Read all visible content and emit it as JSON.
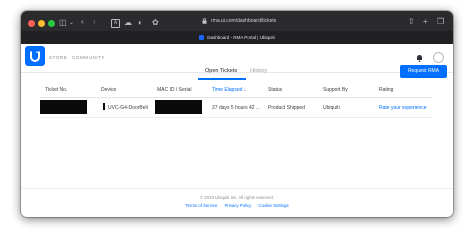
{
  "browser": {
    "address": "rma.ui.com/dashboard/tickets",
    "tab_title": "Dashboard - RMA Portal | Ubiquiti"
  },
  "nav": {
    "store": "STORE",
    "community": "COMMUNITY"
  },
  "subtabs": [
    {
      "label": "Open Tickets",
      "active": true
    },
    {
      "label": "History",
      "active": false
    }
  ],
  "request_rma_label": "Request RMA",
  "table": {
    "columns": [
      "Ticket No.",
      "Device",
      "MAC ID / Serial",
      "Time Elapsed",
      "Status",
      "Support By",
      "Rating"
    ],
    "sorted_column": "Time Elapsed",
    "rows": [
      {
        "ticket_no": "",
        "device": "UVC-G4-DoorBell",
        "mac_serial": "",
        "time_elapsed": "27 days 5 hours 42 ...",
        "status": "Product Shipped",
        "support_by": "Ubiquiti",
        "rating": "Rate your experience"
      }
    ]
  },
  "footer": {
    "copyright": "© 2023 Ubiquiti Inc. All rights reserved.",
    "links": [
      "Terms of Service",
      "Privacy Policy",
      "Cookie Settings"
    ]
  },
  "colors": {
    "accent": "#006fff",
    "titlebar": "#2b2b2d",
    "traffic_red": "#ff5f57",
    "traffic_yellow": "#febc2e",
    "traffic_green": "#28c840"
  }
}
